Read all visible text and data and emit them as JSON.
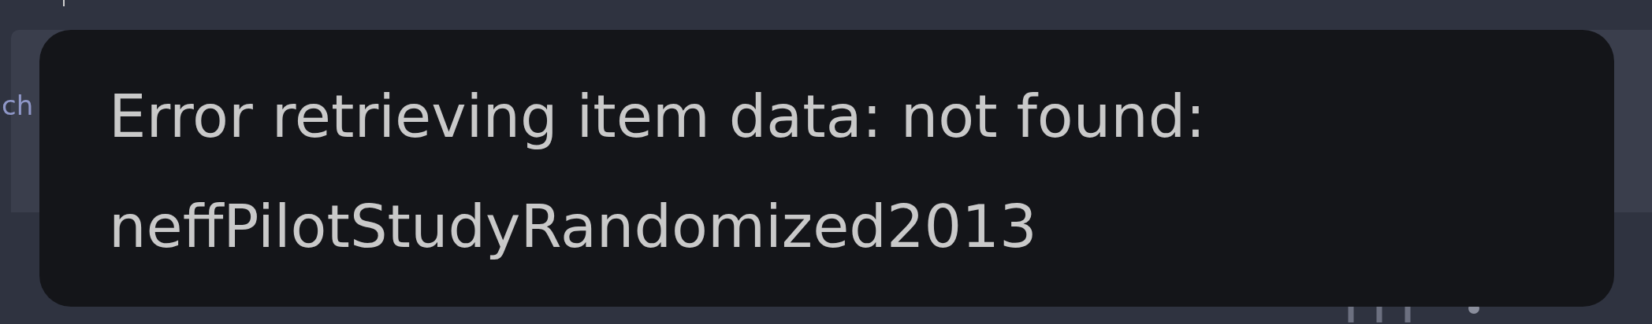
{
  "toolbar": {
    "search_text": "ch"
  },
  "toast": {
    "message": "Error retrieving item data: not found: neffPilotStudyRandomized2013"
  }
}
